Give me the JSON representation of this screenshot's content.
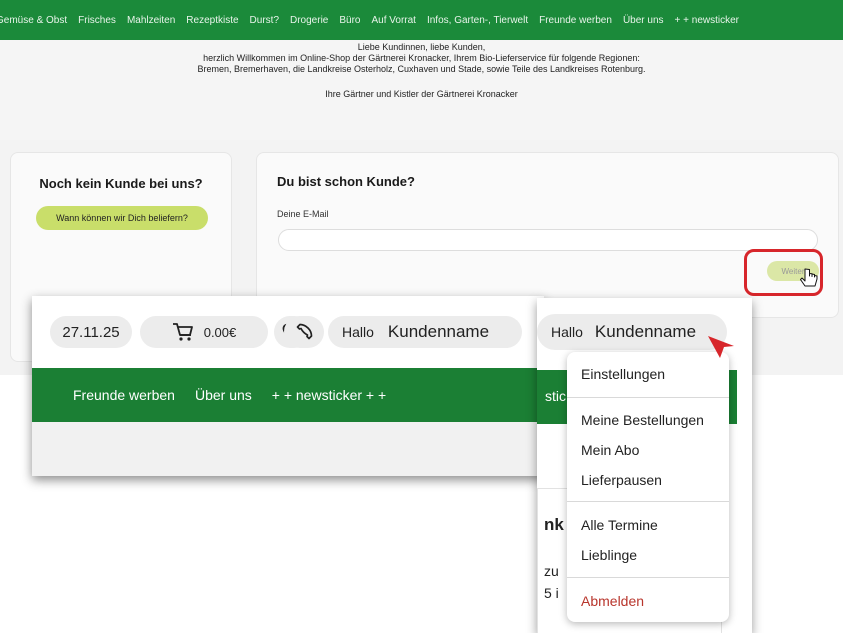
{
  "bg": {
    "nav_items": [
      "Gemüse & Obst",
      "Frisches",
      "Mahlzeiten",
      "Rezeptkiste",
      "Durst?",
      "Drogerie",
      "Büro",
      "Auf Vorrat",
      "Infos, Garten-, Tierwelt",
      "Freunde werben",
      "Über uns",
      "+ + newsticker"
    ],
    "welcome": {
      "line1": "Liebe Kundinnen, liebe Kunden,",
      "line2": "herzlich Willkommen im Online-Shop der Gärtnerei Kronacker, Ihrem Bio-Lieferservice für folgende Regionen:",
      "line3": "Bremen, Bremerhaven, die Landkreise Osterholz, Cuxhaven und Stade, sowie Teile des Landkreises Rotenburg.",
      "signature": "Ihre Gärtner und Kistler der Gärtnerei Kronacker"
    },
    "new_customer": {
      "title": "Noch kein Kunde bei uns?",
      "button": "Wann können wir Dich beliefern?"
    },
    "login": {
      "title": "Du bist schon Kunde?",
      "email_label": "Deine E-Mail",
      "email_value": "",
      "submit": "Weiter"
    }
  },
  "header": {
    "date": "27.11.25",
    "cart_amount": "0.00€",
    "greeting": "Hallo",
    "customer_name": "Kundenname"
  },
  "zoom_nav": [
    "Freunde werben",
    "Über uns",
    "+ + newsticker + +"
  ],
  "dropdown_crop": {
    "greeting": "Hallo",
    "customer_name": "Kundenname",
    "nav_fragment": "stic",
    "under_big": "nk",
    "under_line1": "zu",
    "under_line2": "5 i"
  },
  "user_menu": {
    "items": [
      {
        "label": "Einstellungen"
      },
      {
        "label": "Meine Bestellungen"
      },
      {
        "label": "Mein Abo"
      },
      {
        "label": "Lieferpausen"
      },
      {
        "label": "Alle Termine"
      },
      {
        "label": "Lieblinge"
      },
      {
        "label": "Abmelden"
      }
    ]
  },
  "colors": {
    "nav_green": "#1b7f34",
    "button_lime": "#c9de6a",
    "highlight_red": "#d7262b",
    "logout_red": "#b8352c"
  },
  "icons": [
    "cart-icon",
    "heart-icon",
    "phone-icon",
    "pointer-cursor-icon",
    "arrow-icon"
  ]
}
